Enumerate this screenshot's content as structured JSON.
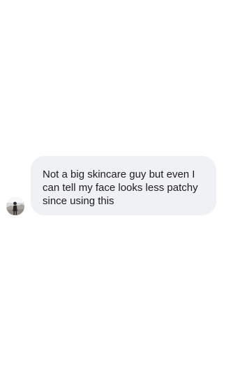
{
  "chat": {
    "messages": [
      {
        "sender_avatar_icon": "user-avatar",
        "text": "Not a big skincare guy but even I\ncan tell my face looks less patchy\nsince using this"
      }
    ]
  }
}
